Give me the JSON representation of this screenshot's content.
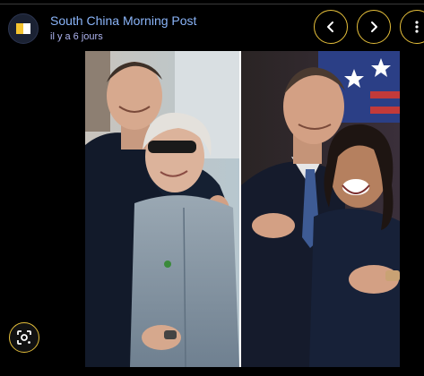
{
  "source": {
    "name": "South China Morning Post",
    "time": "il y a 6 jours",
    "logo_icon": "scmp-logo-icon"
  },
  "nav": {
    "prev_icon": "chevron-left-icon",
    "next_icon": "chevron-right-icon",
    "more_icon": "more-vertical-icon"
  },
  "image": {
    "left_panel": "man-hugging-older-woman-photo",
    "right_panel": "man-hugging-laughing-woman-photo"
  },
  "lens": {
    "icon": "visual-search-icon"
  },
  "colors": {
    "accent_border": "#e5bf3a",
    "link": "#8ab4f8",
    "background": "#000000"
  }
}
